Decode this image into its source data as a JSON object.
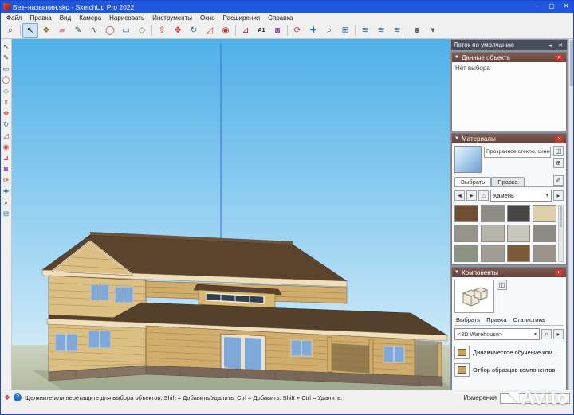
{
  "window": {
    "title": "Без+названия.skp - SketchUp Pro 2022",
    "minimize_glyph": "–",
    "maximize_glyph": "▢",
    "close_glyph": "✕"
  },
  "menu": {
    "items": [
      "Файл",
      "Правка",
      "Вид",
      "Камера",
      "Нарисовать",
      "Инструменты",
      "Окно",
      "Расширения",
      "Справка"
    ]
  },
  "toolbar": {
    "icons": [
      {
        "name": "search",
        "glyph": "⌕",
        "color": "#333333"
      },
      {
        "name": "select",
        "glyph": "↖",
        "color": "#111111"
      },
      {
        "name": "make-component",
        "glyph": "❖",
        "color": "#9a6a2f"
      },
      {
        "name": "eraser",
        "glyph": "▰",
        "color": "#e08aa4"
      },
      {
        "name": "line",
        "glyph": "✎",
        "color": "#454545"
      },
      {
        "name": "freehand",
        "glyph": "∿",
        "color": "#454545"
      },
      {
        "name": "circle",
        "glyph": "◯",
        "color": "#b03a2e"
      },
      {
        "name": "rectangle",
        "glyph": "▭",
        "color": "#2e6da4"
      },
      {
        "name": "polygon",
        "glyph": "◇",
        "color": "#2e7d32"
      },
      {
        "name": "push-pull",
        "glyph": "⇧",
        "color": "#c0392b"
      },
      {
        "name": "move",
        "glyph": "✥",
        "color": "#c0392b"
      },
      {
        "name": "rotate",
        "glyph": "↻",
        "color": "#2e6da4"
      },
      {
        "name": "scale",
        "glyph": "◿",
        "color": "#b03a2e"
      },
      {
        "name": "offset",
        "glyph": "◉",
        "color": "#c0392b"
      },
      {
        "name": "tape-measure",
        "glyph": "⊿",
        "color": "#c2185b"
      },
      {
        "name": "text",
        "glyph": "A1",
        "color": "#111111"
      },
      {
        "name": "paint-bucket",
        "glyph": "◙",
        "color": "#8e44ad"
      },
      {
        "name": "orbit",
        "glyph": "⟳",
        "color": "#c0392b"
      },
      {
        "name": "pan",
        "glyph": "✚",
        "color": "#2e6da4"
      },
      {
        "name": "zoom",
        "glyph": "⌕",
        "color": "#333333"
      },
      {
        "name": "zoom-extents",
        "glyph": "⊞",
        "color": "#2e6da4"
      },
      {
        "name": "sandbox-1",
        "glyph": "≋",
        "color": "#2e6da4"
      },
      {
        "name": "sandbox-2",
        "glyph": "≋",
        "color": "#2e6da4"
      },
      {
        "name": "sandbox-3",
        "glyph": "≋",
        "color": "#2e6da4"
      },
      {
        "name": "account",
        "glyph": "☻",
        "color": "#555555"
      },
      {
        "name": "account-caret",
        "glyph": "▾",
        "color": "#555555"
      }
    ]
  },
  "left_toolbar": {
    "icons": [
      {
        "name": "select",
        "glyph": "↖",
        "color": "#111111"
      },
      {
        "name": "line",
        "glyph": "✎",
        "color": "#454545"
      },
      {
        "name": "rectangle",
        "glyph": "▭",
        "color": "#2e6da4"
      },
      {
        "name": "circle",
        "glyph": "◯",
        "color": "#b03a2e"
      },
      {
        "name": "polygon",
        "glyph": "◇",
        "color": "#2e7d32"
      },
      {
        "name": "push-pull",
        "glyph": "⇧",
        "color": "#c0392b"
      },
      {
        "name": "move",
        "glyph": "✥",
        "color": "#c0392b"
      },
      {
        "name": "rotate",
        "glyph": "↻",
        "color": "#2e6da4"
      },
      {
        "name": "scale",
        "glyph": "◿",
        "color": "#b03a2e"
      },
      {
        "name": "offset",
        "glyph": "◉",
        "color": "#c0392b"
      },
      {
        "name": "tape-measure",
        "glyph": "⊿",
        "color": "#c2185b"
      },
      {
        "name": "paint-bucket",
        "glyph": "◙",
        "color": "#8e44ad"
      },
      {
        "name": "orbit",
        "glyph": "⟳",
        "color": "#c0392b"
      },
      {
        "name": "pan",
        "glyph": "✚",
        "color": "#2e6da4"
      },
      {
        "name": "zoom",
        "glyph": "⌕",
        "color": "#333333"
      },
      {
        "name": "zoom-extents",
        "glyph": "⊞",
        "color": "#2e6da4"
      }
    ]
  },
  "glyphs": {
    "pin": "◂",
    "close": "✕",
    "collapse": "▼",
    "back": "◄",
    "forward": "►",
    "home": "⌂",
    "dropdown": "▾",
    "detail": "▸",
    "eyedropper": "✐",
    "search": "⌕",
    "create": "⊕",
    "secondary": "◫",
    "brush": "◪",
    "help": "?",
    "geo": "❖"
  },
  "tray": {
    "title": "Лоток по умолчанию",
    "entity_info": {
      "title": "Данные объекта",
      "empty_text": "Нет выбора"
    },
    "materials": {
      "title": "Материалы",
      "material_name": "Прозрачное стекло, синее",
      "tabs": [
        "Выбрать",
        "Правка"
      ],
      "category": "Камень",
      "swatches": [
        "#6e4f33",
        "#8f8c83",
        "#474645",
        "#ddd0ab",
        "#96938b",
        "#b7b4ab",
        "#c9c6bd",
        "#8d8b84",
        "#8b9383",
        "#a29e96",
        "#7b5a39",
        "#9a948a"
      ]
    },
    "components": {
      "title": "Компоненты",
      "tabs": [
        "Выбрать",
        "Правка",
        "Статистика"
      ],
      "search_value": "<3D Warehouse>",
      "items": [
        "Динамическое обучение ком...",
        "Отбор образцов компонентов"
      ]
    }
  },
  "statusbar": {
    "hint": "Щелкните или перетащите для выбора объектов. Shift = Добавить/Удалить. Ctrl = Добавить. Shift + Ctrl = Удалить.",
    "measurements_label": "Измерения"
  },
  "watermark": {
    "text": "Avito"
  },
  "viewport": {
    "scene": "two-storey log house 3d model",
    "sky_top": "#4fb0e8",
    "sky_horizon": "#cdeaf8",
    "ground": "#bcc4ab",
    "axis_color": "#3f5fd6",
    "wall_color": "#dcc083",
    "roof_color": "#5b432d",
    "glass_color": "#7fa9d9"
  }
}
